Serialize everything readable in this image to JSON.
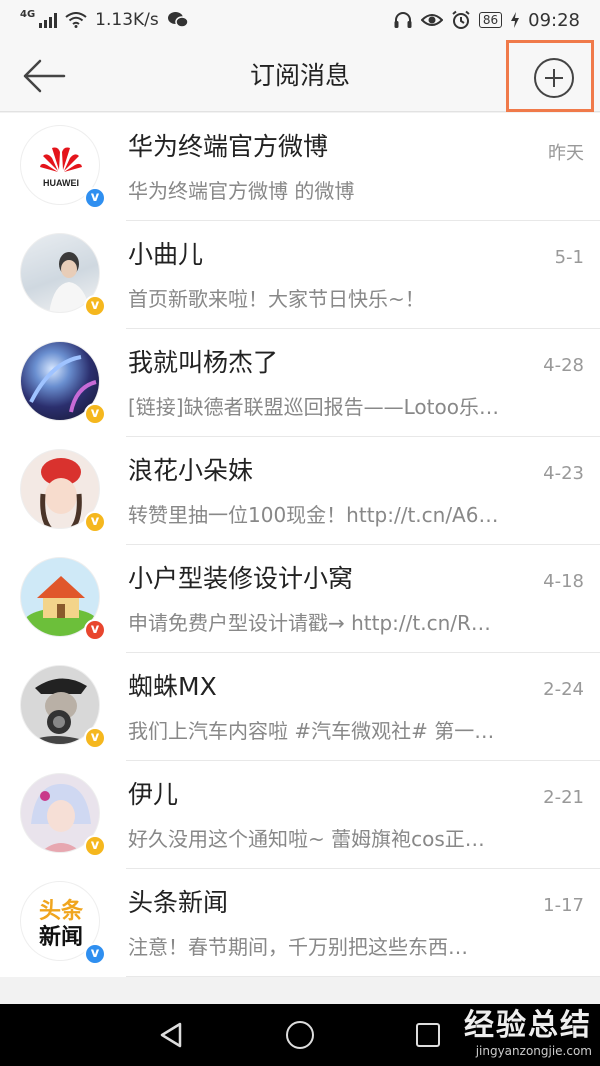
{
  "status_bar": {
    "network_type": "4G",
    "speed": "1.13K/s",
    "battery": "86",
    "time": "09:28"
  },
  "header": {
    "title": "订阅消息"
  },
  "subscriptions": [
    {
      "name": "华为终端官方微博",
      "time": "昨天",
      "snippet": "华为终端官方微博 的微博",
      "badge_color": "#2f8ff0",
      "avatar_text": "HUAWEI"
    },
    {
      "name": "小曲儿",
      "time": "5-1",
      "snippet": "首页新歌来啦！大家节日快乐~！",
      "badge_color": "#f5b71e"
    },
    {
      "name": "我就叫杨杰了",
      "time": "4-28",
      "snippet": "[链接]缺德者联盟巡回报告——Lotoo乐…",
      "badge_color": "#f5b71e"
    },
    {
      "name": "浪花小朵妹",
      "time": "4-23",
      "snippet": "转赞里抽一位100现金！http://t.cn/A6…",
      "badge_color": "#f5b71e"
    },
    {
      "name": "小户型装修设计小窝",
      "time": "4-18",
      "snippet": "申请免费户型设计请戳→ http://t.cn/R…",
      "badge_color": "#e8462e"
    },
    {
      "name": "蜘蛛MX",
      "time": "2-24",
      "snippet": "我们上汽车内容啦 #汽车微观社# 第一…",
      "badge_color": "#f5b71e"
    },
    {
      "name": "伊儿",
      "time": "2-21",
      "snippet": "好久没用这个通知啦~ 蕾姆旗袍cos正…",
      "badge_color": "#f5b71e"
    },
    {
      "name": "头条新闻",
      "time": "1-17",
      "snippet": "注意！春节期间，千万别把这些东西…",
      "badge_color": "#2f8ff0",
      "avatar_text": [
        "头条",
        "新闻"
      ]
    }
  ],
  "watermark": {
    "line1": "经验总结",
    "line2": "jingyanzongjie.com"
  },
  "colors": {
    "highlight": "#f07a4a",
    "verified_blue": "#2f8ff0",
    "verified_orange": "#f5b71e",
    "verified_red": "#e8462e"
  }
}
